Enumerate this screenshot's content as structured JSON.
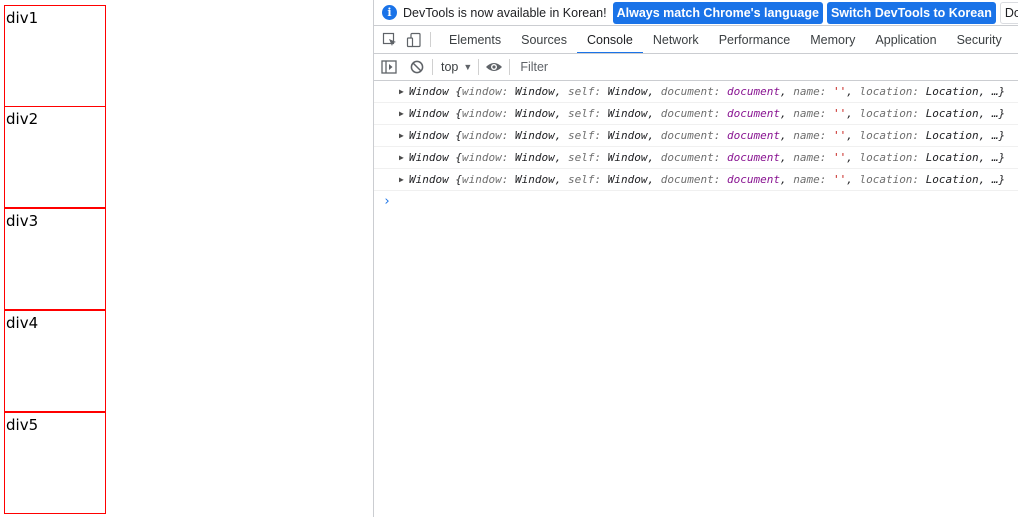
{
  "page": {
    "boxes": [
      {
        "label": "div1"
      },
      {
        "label": "div2"
      },
      {
        "label": "div3"
      },
      {
        "label": "div4"
      },
      {
        "label": "div5"
      }
    ],
    "box_border_color": "#ff0000"
  },
  "devtools": {
    "infobar": {
      "icon": "info-icon",
      "message": "DevTools is now available in Korean!",
      "match_button": "Always match Chrome's language",
      "switch_button": "Switch DevTools to Korean",
      "dismiss_button": "Don't show"
    },
    "tabs": [
      "Elements",
      "Sources",
      "Console",
      "Network",
      "Performance",
      "Memory",
      "Application",
      "Security"
    ],
    "active_tab": "Console",
    "toolbar": {
      "context": "top",
      "filter_placeholder": "Filter"
    },
    "messages": [
      {
        "class": "Window",
        "window": "Window",
        "self": "Window",
        "document": "document",
        "name": "''",
        "location": "Location",
        "ellipsis": "…}"
      },
      {
        "class": "Window",
        "window": "Window",
        "self": "Window",
        "document": "document",
        "name": "''",
        "location": "Location",
        "ellipsis": "…}"
      },
      {
        "class": "Window",
        "window": "Window",
        "self": "Window",
        "document": "document",
        "name": "''",
        "location": "Location",
        "ellipsis": "…}"
      },
      {
        "class": "Window",
        "window": "Window",
        "self": "Window",
        "document": "document",
        "name": "''",
        "location": "Location",
        "ellipsis": "…}"
      },
      {
        "class": "Window",
        "window": "Window",
        "self": "Window",
        "document": "document",
        "name": "''",
        "location": "Location",
        "ellipsis": "…}"
      }
    ],
    "prompt_symbol": "›",
    "accent_color": "#1a73e8"
  }
}
